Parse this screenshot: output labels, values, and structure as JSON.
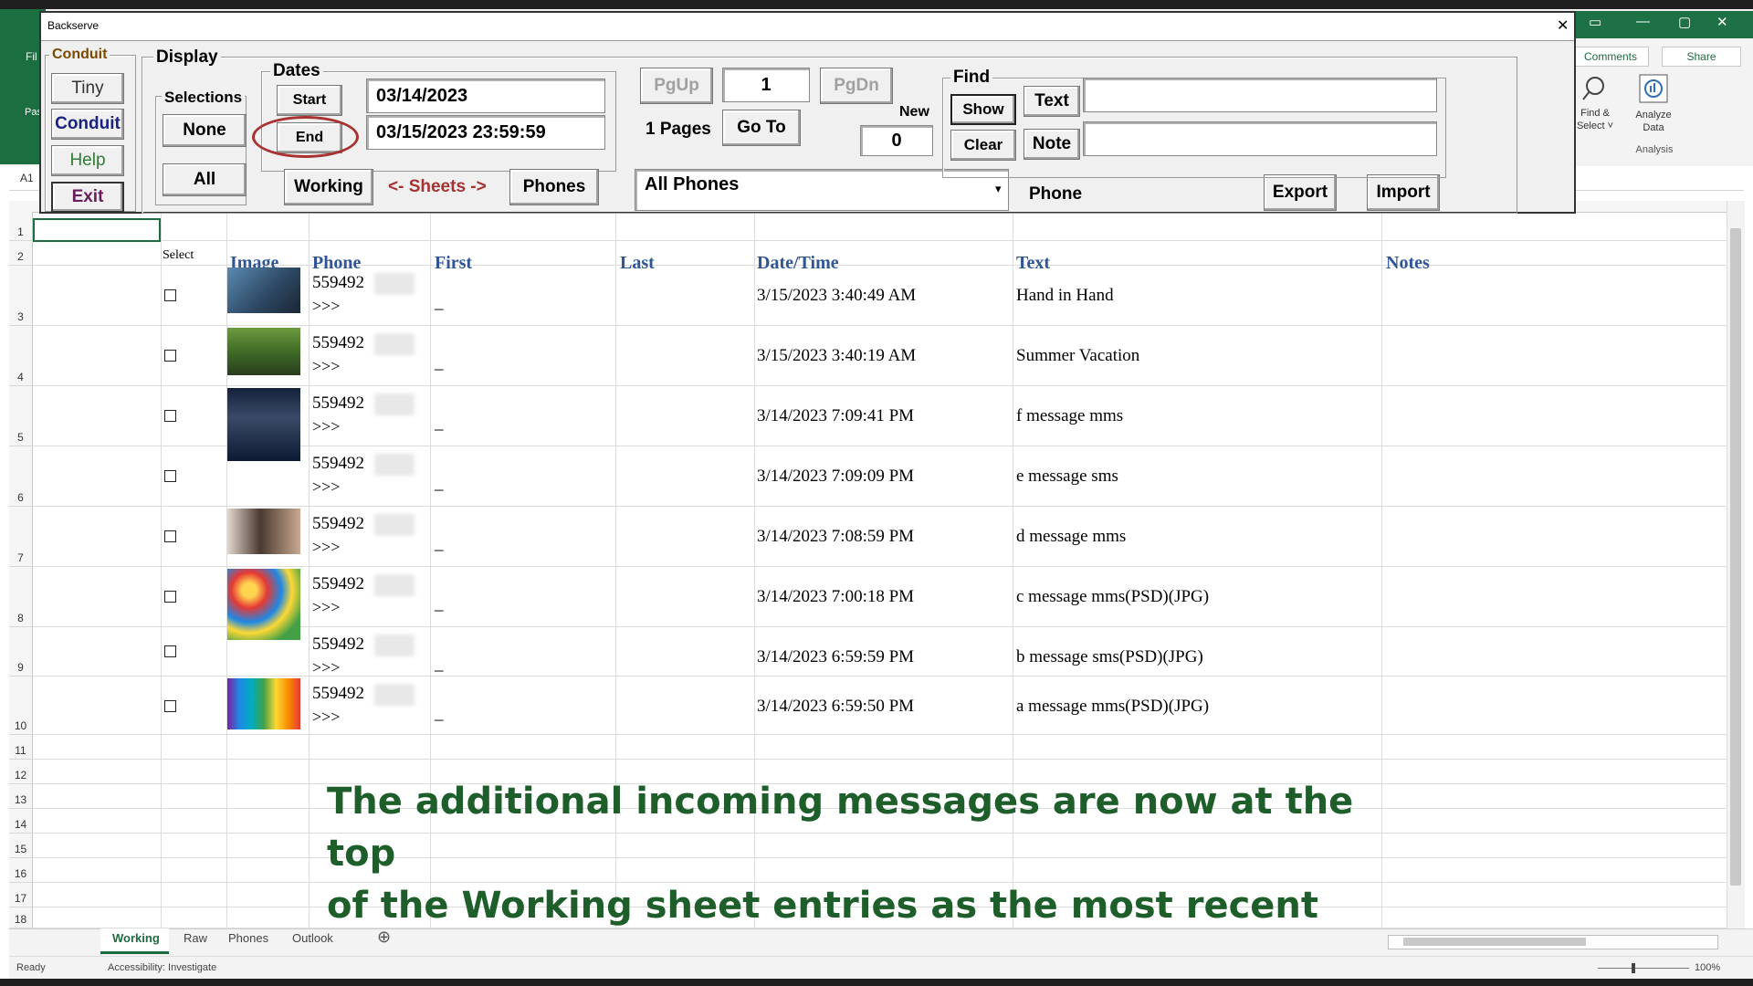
{
  "dialog": {
    "title": "Backserve",
    "close_glyph": "✕",
    "conduit_group": {
      "label": "Conduit",
      "buttons": [
        "Tiny",
        "Conduit",
        "Help",
        "Exit"
      ]
    },
    "display_group": {
      "label": "Display"
    },
    "selections_group": {
      "label": "Selections",
      "none_label": "None",
      "all_label": "All"
    },
    "dates_group": {
      "label": "Dates",
      "start_label": "Start",
      "end_label": "End",
      "start_value": "03/14/2023",
      "end_value": "03/15/2023 23:59:59"
    },
    "sheets": {
      "working_label": "Working",
      "arrow_label": "<- Sheets ->",
      "phones_label": "Phones"
    },
    "paging": {
      "pgup_label": "PgUp",
      "pgdn_label": "PgDn",
      "page_value": "1",
      "pages_label": "1 Pages",
      "goto_label": "Go To",
      "new_label": "New",
      "new_value": "0"
    },
    "phone_select": {
      "value": "All Phones",
      "dropdown_glyph": "▾"
    },
    "phone_label": "Phone",
    "export_label": "Export",
    "import_label": "Import",
    "find_group": {
      "label": "Find",
      "show_label": "Show",
      "clear_label": "Clear",
      "text_label": "Text",
      "note_label": "Note",
      "text_value": "",
      "note_value": ""
    }
  },
  "excel": {
    "file_tab": "Fil",
    "paste_label": "Pas",
    "name_box": "A1",
    "comments_label": "Comments",
    "share_label": "Share",
    "find_select_label": [
      "Find &",
      "Select ˅"
    ],
    "analyze_label": [
      "Analyze",
      "Data"
    ],
    "analysis_group": "Analysis",
    "window_buttons": [
      "▭",
      "—",
      "▢",
      "✕"
    ]
  },
  "sheet": {
    "column_headers": {
      "select": "Select",
      "image": "Image",
      "phone": "Phone",
      "first": "First",
      "last": "Last",
      "datetime": "Date/Time",
      "text": "Text",
      "notes": "Notes"
    },
    "row_numbers": [
      "1",
      "2",
      "3",
      "4",
      "5",
      "6",
      "7",
      "8",
      "9",
      "10",
      "11",
      "12",
      "13",
      "14",
      "15",
      "16",
      "17",
      "18"
    ],
    "rows": [
      {
        "phone": "559492",
        "reply": ">>>",
        "first": "_",
        "datetime": "3/15/2023 3:40:49 AM",
        "text": "Hand in Hand",
        "image": "hands"
      },
      {
        "phone": "559492",
        "reply": ">>>",
        "first": "_",
        "datetime": "3/15/2023 3:40:19 AM",
        "text": "Summer Vacation",
        "image": "forest"
      },
      {
        "phone": "559492",
        "reply": ">>>",
        "first": "_",
        "datetime": "3/14/2023 7:09:41 PM",
        "text": "f message mms",
        "image": "hand-dark"
      },
      {
        "phone": "559492",
        "reply": ">>>",
        "first": "_",
        "datetime": "3/14/2023 7:09:09 PM",
        "text": "e message sms",
        "image": ""
      },
      {
        "phone": "559492",
        "reply": ">>>",
        "first": "_",
        "datetime": "3/14/2023 7:08:59 PM",
        "text": "d message mms",
        "image": "portrait"
      },
      {
        "phone": "559492",
        "reply": ">>>",
        "first": "_",
        "datetime": "3/14/2023 7:00:18 PM",
        "text": "c message mms(PSD)(JPG)",
        "image": "balls"
      },
      {
        "phone": "559492",
        "reply": ">>>",
        "first": "_",
        "datetime": "3/14/2023 6:59:59 PM",
        "text": "b message sms(PSD)(JPG)",
        "image": ""
      },
      {
        "phone": "559492",
        "reply": ">>>",
        "first": "_",
        "datetime": "3/14/2023 6:59:50 PM",
        "text": "a message mms(PSD)(JPG)",
        "image": "rainbow"
      }
    ],
    "tabs": [
      "Working",
      "Raw",
      "Phones",
      "Outlook"
    ],
    "add_sheet_glyph": "⊕",
    "annotation_line1": "The additional incoming messages are now at the top",
    "annotation_line2": "of the Working sheet entries as the most recent"
  },
  "status": {
    "ready": "Ready",
    "accessibility": "Accessibility: Investigate",
    "zoom": "100%"
  }
}
